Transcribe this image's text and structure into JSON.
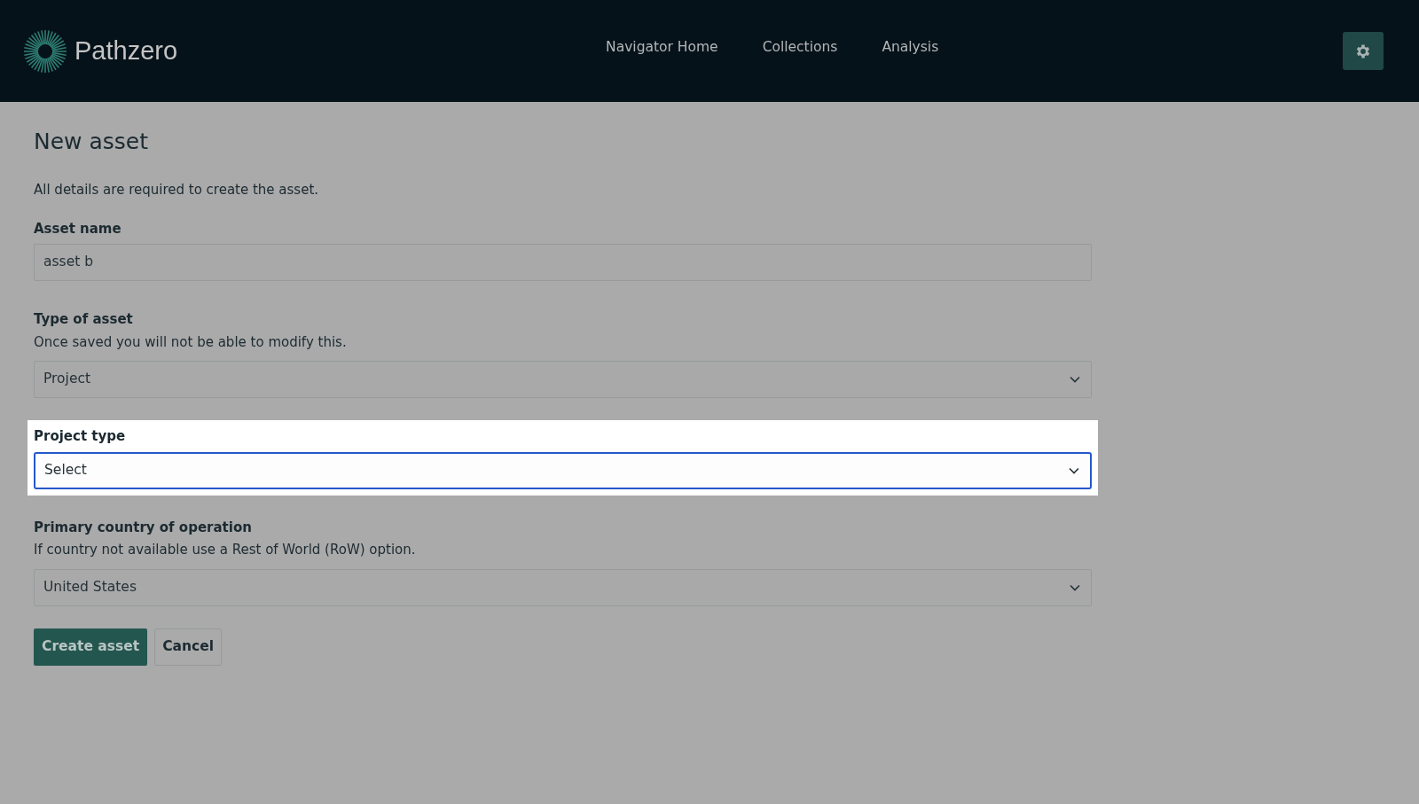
{
  "brand": {
    "name": "Pathzero"
  },
  "nav": [
    {
      "label": "Navigator Home"
    },
    {
      "label": "Collections"
    },
    {
      "label": "Analysis"
    }
  ],
  "page": {
    "title": "New asset",
    "intro": "All details are required to create the asset."
  },
  "fields": [
    {
      "kind": "text",
      "label": "Asset name",
      "value": "asset b",
      "highlighted": false
    },
    {
      "kind": "select",
      "label": "Type of asset",
      "help": "Once saved you will not be able to modify this.",
      "value": "Project",
      "highlighted": false
    },
    {
      "kind": "select",
      "label": "Project type",
      "value": "Select",
      "highlighted": true
    },
    {
      "kind": "select",
      "label": "Primary country of operation",
      "help": "If country not available use a Rest of World (RoW) option.",
      "value": "United States",
      "highlighted": false
    }
  ],
  "buttons": [
    {
      "kind": "primary",
      "label": "Create asset"
    },
    {
      "kind": "secondary",
      "label": "Cancel"
    }
  ]
}
